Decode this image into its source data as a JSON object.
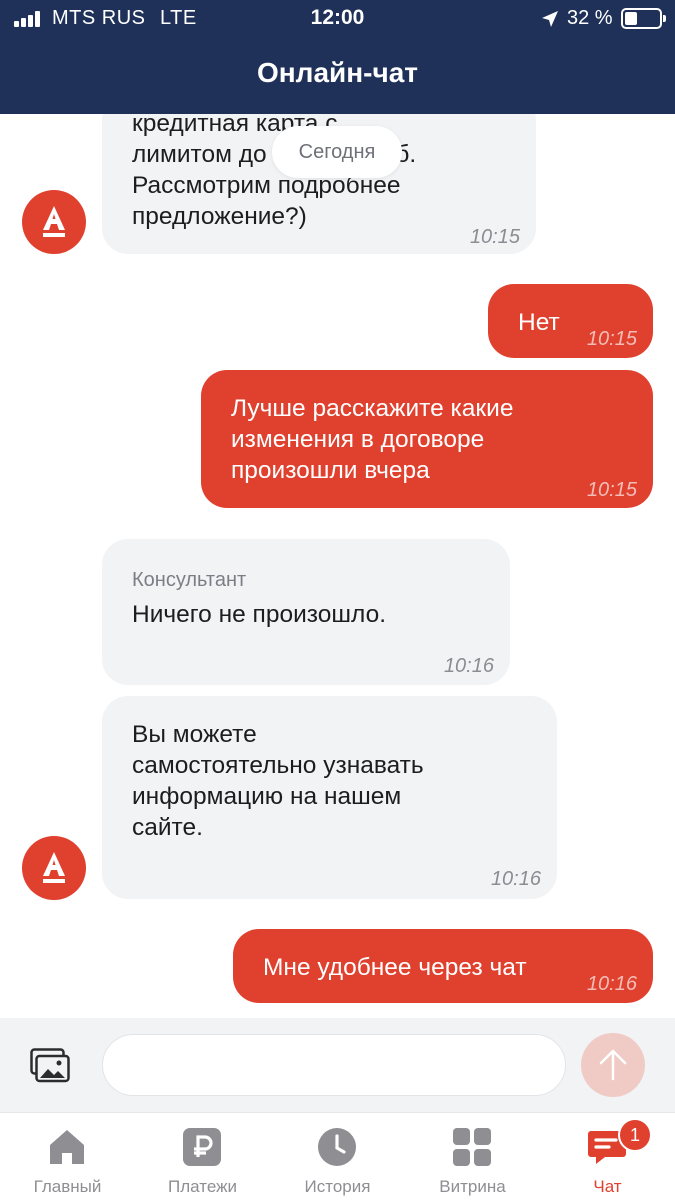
{
  "status_bar": {
    "carrier": "MTS RUS",
    "network": "LTE",
    "time": "12:00",
    "battery": "32 %"
  },
  "header": {
    "title": "Онлайн-чат"
  },
  "chat": {
    "date_chip": "Сегодня",
    "messages": [
      {
        "direction": "incoming",
        "lines": [
          "кредитная карта с",
          "лимитом до",
          "руб.",
          "Рассмотрим подробнее",
          "предложение?)"
        ],
        "time": "10:15",
        "avatar": "alfa-logo"
      },
      {
        "direction": "outgoing",
        "text": "Нет",
        "time": "10:15"
      },
      {
        "direction": "outgoing",
        "lines": [
          "Лучше расскажите какие",
          "изменения в договоре",
          "произошли вчера"
        ],
        "time": "10:15"
      },
      {
        "direction": "incoming",
        "sender": "Консультант",
        "text": "Ничего не произошло.",
        "time": "10:16"
      },
      {
        "direction": "incoming",
        "lines": [
          "Вы можете",
          "самостоятельно узнавать",
          "информацию на нашем",
          "сайте."
        ],
        "time": "10:16",
        "avatar": "alfa-logo"
      },
      {
        "direction": "outgoing",
        "text": "Мне удобнее через чат",
        "time": "10:16"
      }
    ]
  },
  "composer": {
    "value": "",
    "placeholder": ""
  },
  "tabs": [
    {
      "label": "Главный",
      "icon": "home-icon"
    },
    {
      "label": "Платежи",
      "icon": "ruble-icon"
    },
    {
      "label": "История",
      "icon": "clock-icon"
    },
    {
      "label": "Витрина",
      "icon": "grid-icon"
    },
    {
      "label": "Чат",
      "icon": "chat-icon",
      "active": true,
      "badge": "1"
    }
  ],
  "colors": {
    "header": "#1f3158",
    "accent": "#e0412f",
    "incoming_bubble": "#f2f3f5"
  }
}
